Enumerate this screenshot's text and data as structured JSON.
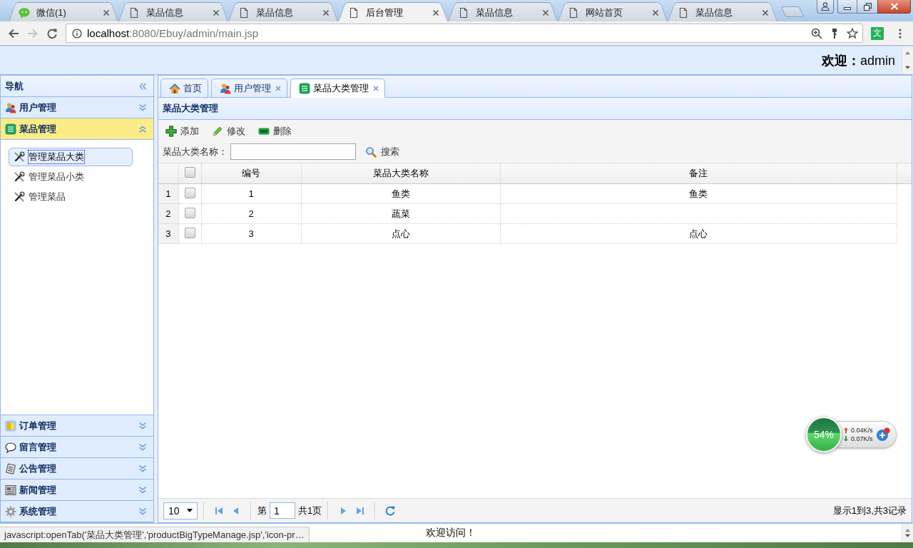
{
  "browser": {
    "tabs": [
      {
        "title": "微信(1)",
        "kind": "chat",
        "selected": false
      },
      {
        "title": "菜品信息",
        "kind": "page",
        "selected": false
      },
      {
        "title": "菜品信息",
        "kind": "page",
        "selected": false
      },
      {
        "title": "后台管理",
        "kind": "page",
        "selected": true
      },
      {
        "title": "菜品信息",
        "kind": "page",
        "selected": false
      },
      {
        "title": "网站首页",
        "kind": "page",
        "selected": false
      },
      {
        "title": "菜品信息",
        "kind": "page",
        "selected": false
      }
    ],
    "forward_disabled": true,
    "address": {
      "host": "localhost",
      "rest": ":8080/Ebuy/admin/main.jsp"
    },
    "translate_label": "文",
    "status_link": "javascript:openTab('菜品大类管理','productBigTypeManage.jsp','icon-pr…"
  },
  "header": {
    "welcome": "**欢迎：**admin"
  },
  "sidebar": {
    "title": "导航",
    "sections": [
      {
        "label": "用户管理",
        "kind": "users",
        "expanded": false
      },
      {
        "label": "菜品管理",
        "kind": "list",
        "expanded": true,
        "items": [
          {
            "label": "管理菜品大类",
            "selected": true
          },
          {
            "label": "管理菜品小类",
            "selected": false
          },
          {
            "label": "管理菜品",
            "selected": false
          }
        ]
      },
      {
        "label": "订单管理",
        "kind": "cards",
        "expanded": false
      },
      {
        "label": "留言管理",
        "kind": "speech",
        "expanded": false
      },
      {
        "label": "公告管理",
        "kind": "notepad",
        "expanded": false
      },
      {
        "label": "新闻管理",
        "kind": "newspaper",
        "expanded": false
      },
      {
        "label": "系统管理",
        "kind": "gear",
        "expanded": false
      }
    ]
  },
  "tabs": [
    {
      "label": "首页",
      "kind": "home",
      "closable": false,
      "selected": false
    },
    {
      "label": "用户管理",
      "kind": "users",
      "closable": true,
      "selected": false
    },
    {
      "label": "菜品大类管理",
      "kind": "list",
      "closable": true,
      "selected": true
    }
  ],
  "panel": {
    "title": "菜品大类管理",
    "toolbar": [
      {
        "label": "添加",
        "kind": "add"
      },
      {
        "label": "修改",
        "kind": "edit"
      },
      {
        "label": "删除",
        "kind": "remove"
      }
    ],
    "search": {
      "label": "菜品大类名称：",
      "button": "搜索"
    },
    "table": {
      "header_checked": false,
      "columns": [
        "编号",
        "菜品大类名称",
        "备注"
      ],
      "rows": [
        {
          "row_number": "1",
          "checked": false,
          "id": "1",
          "name": "鱼类",
          "remark": "鱼类"
        },
        {
          "row_number": "2",
          "checked": false,
          "id": "2",
          "name": "蔬菜"
        },
        {
          "row_number": "3",
          "checked": false,
          "id": "3",
          "name": "点心",
          "remark": "点心"
        }
      ]
    },
    "pager": {
      "page_size": "10",
      "page_prefix": "第",
      "page": "1",
      "page_total": "共1页",
      "summary": "显示1到3,共3记录"
    }
  },
  "footer": {
    "text": "欢迎访问！"
  },
  "speed_widget": {
    "percent": "54%",
    "upload": "0.04K/s",
    "download": "0.07K/s"
  }
}
